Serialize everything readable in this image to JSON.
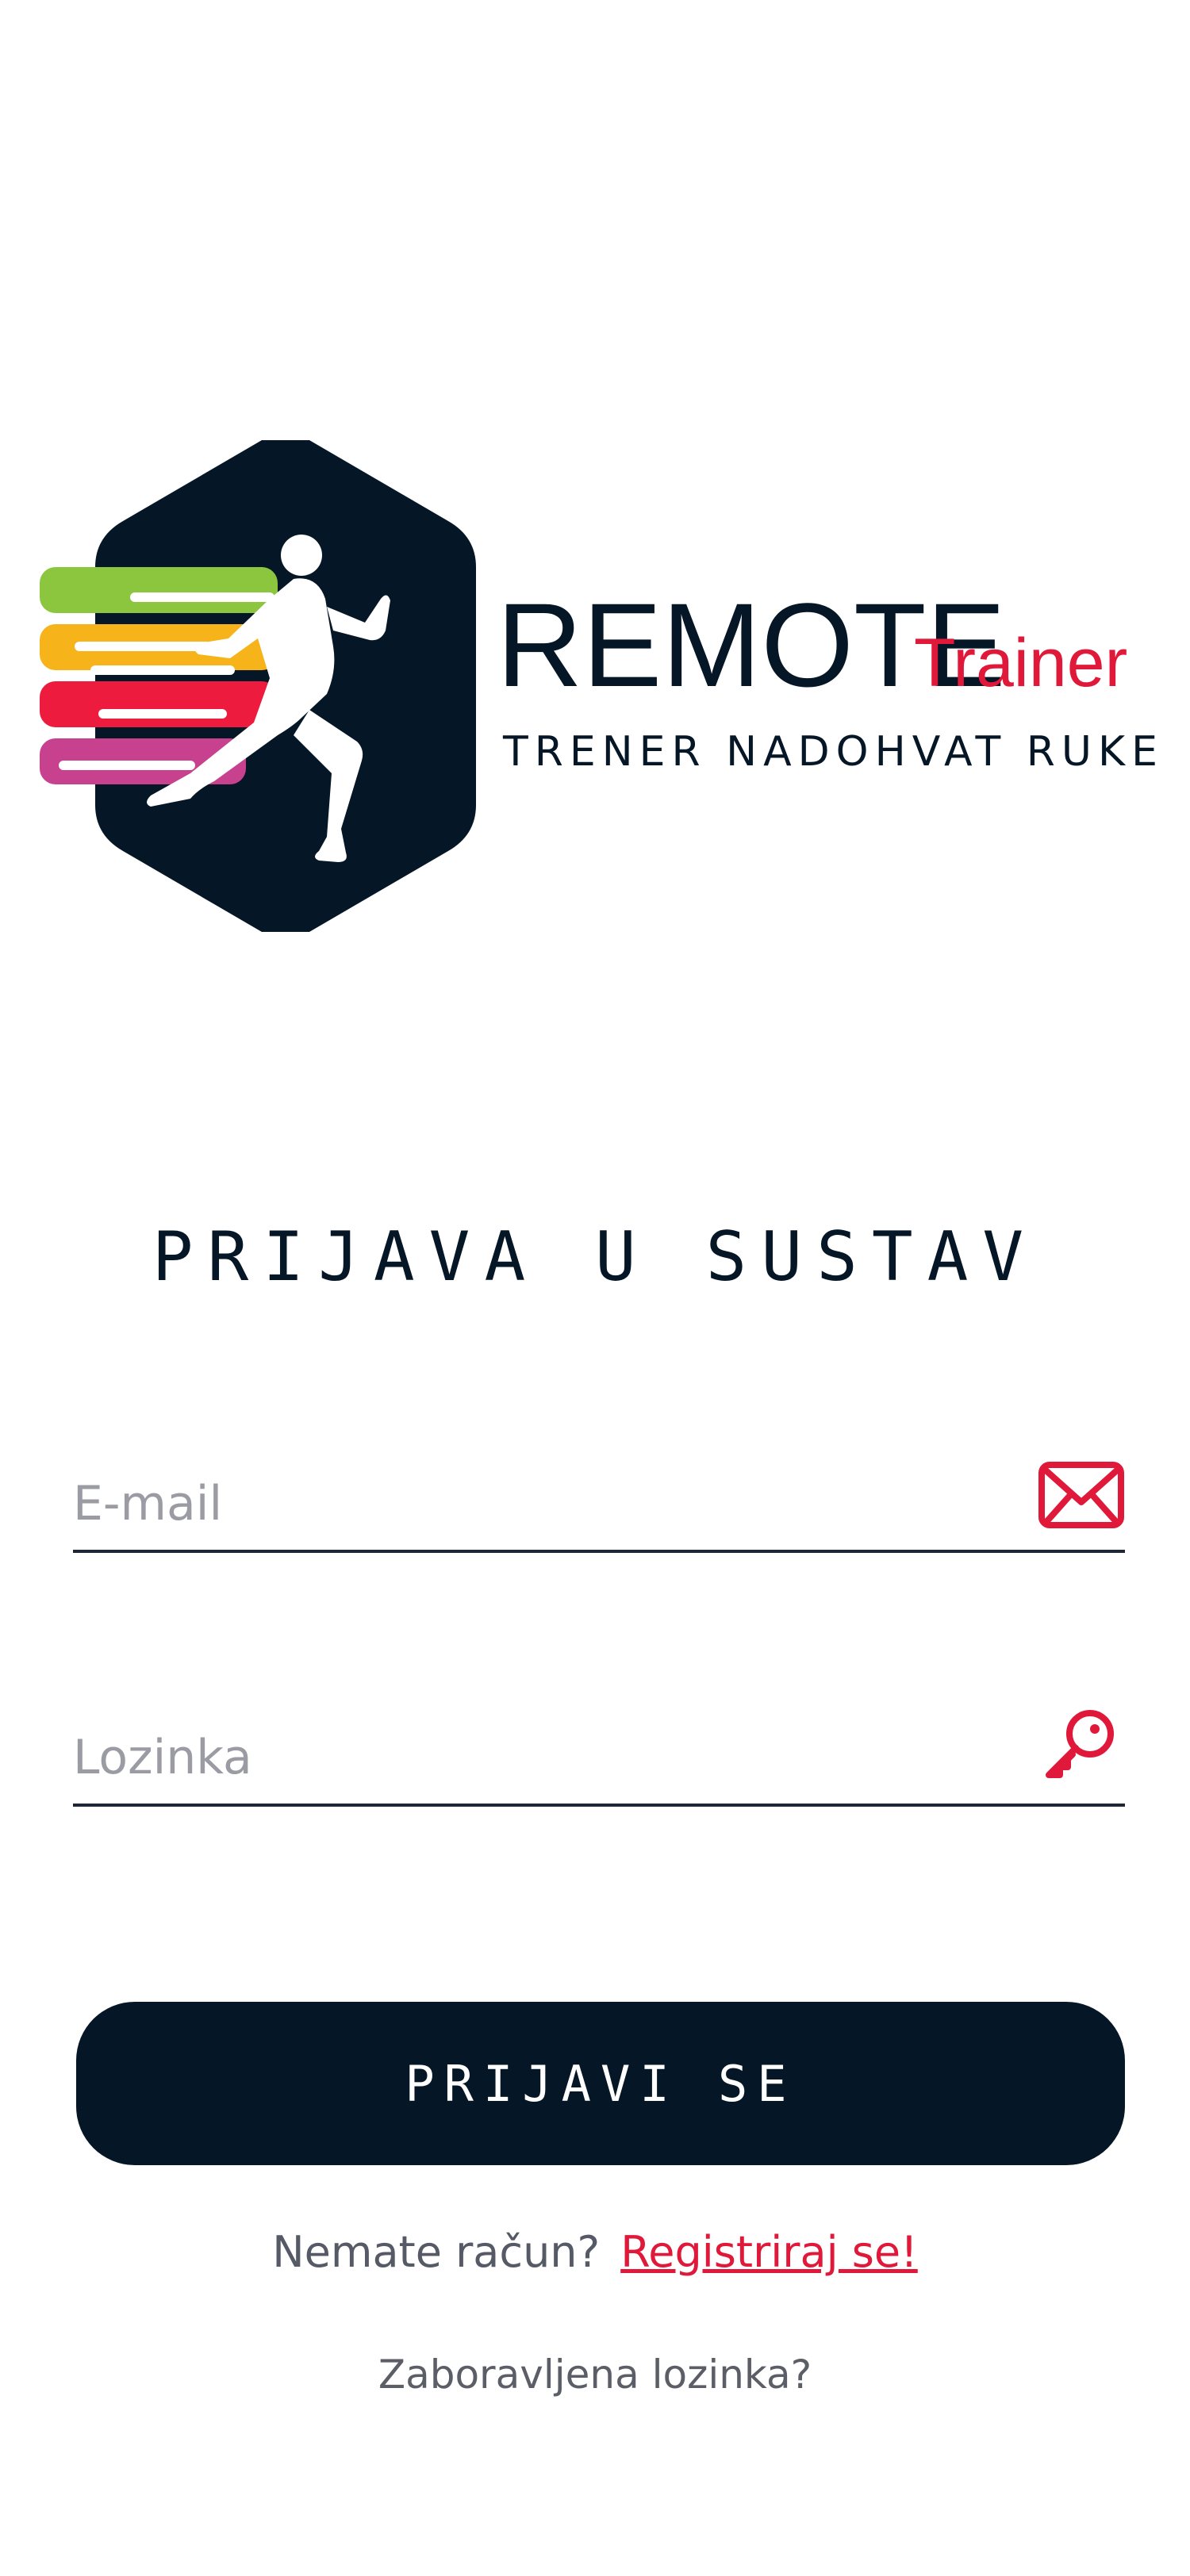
{
  "brand": {
    "name_main": "REMOTE",
    "name_accent": "Trainer",
    "tagline": "TRENER NADOHVAT RUKE",
    "colors": {
      "dark": "#051626",
      "accent": "#e0183a",
      "stripe_green": "#8cc63f",
      "stripe_yellow": "#f6b31a",
      "stripe_red": "#ed1c3f",
      "stripe_magenta": "#c7418f"
    }
  },
  "login": {
    "title": "PRIJAVA U SUSTAV",
    "email_placeholder": "E-mail",
    "email_value": "",
    "email_icon": "envelope-icon",
    "password_placeholder": "Lozinka",
    "password_value": "",
    "password_icon": "key-icon",
    "submit_label": "PRIJAVI SE",
    "no_account_text": "Nemate račun?",
    "register_link": "Registriraj se!",
    "forgot_password": "Zaboravljena lozinka?"
  }
}
